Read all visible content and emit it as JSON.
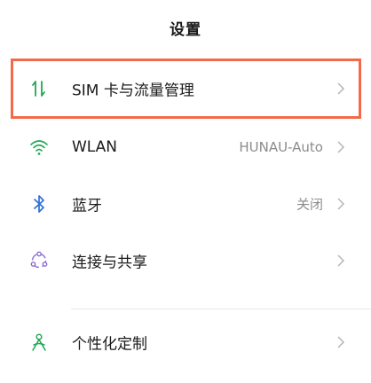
{
  "header": {
    "title": "设置"
  },
  "items": [
    {
      "label": "SIM 卡与流量管理",
      "value": "",
      "icon": "sim-data-icon"
    },
    {
      "label": "WLAN",
      "value": "HUNAU-Auto",
      "icon": "wifi-icon"
    },
    {
      "label": "蓝牙",
      "value": "关闭",
      "icon": "bluetooth-icon"
    },
    {
      "label": "连接与共享",
      "value": "",
      "icon": "connection-share-icon"
    },
    {
      "label": "个性化定制",
      "value": "",
      "icon": "personalization-icon"
    }
  ],
  "colors": {
    "accent": "#1fa855",
    "highlight_border": "#f26a4a",
    "secondary_text": "#8c8c8c"
  }
}
